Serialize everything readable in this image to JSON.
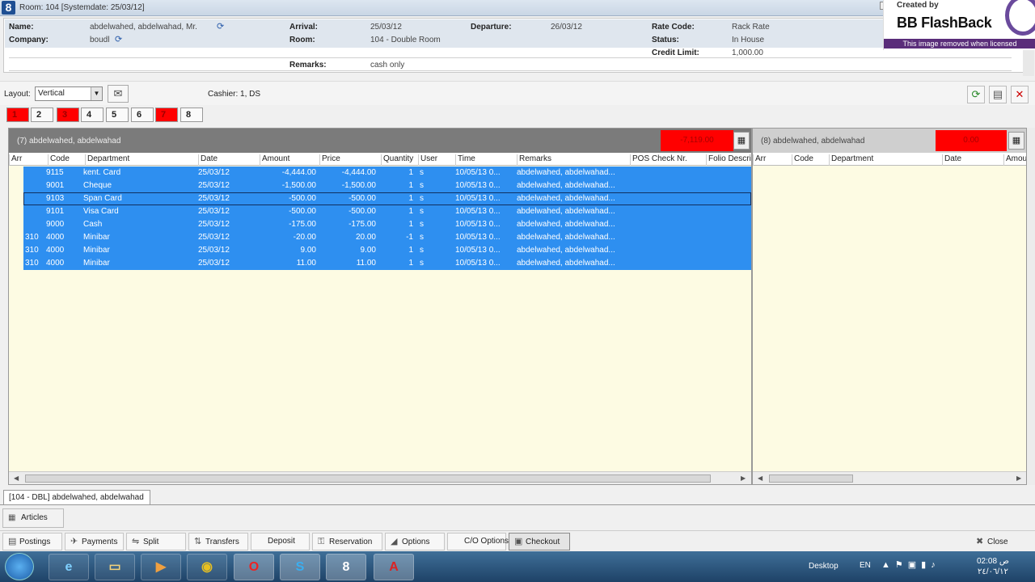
{
  "window": {
    "title": "Room: 104  [Systemdate: 25/03/12]",
    "app_icon": "8"
  },
  "header": {
    "name_label": "Name:",
    "name_value": "abdelwahed, abdelwahad, Mr.",
    "company_label": "Company:",
    "company_value": "boudl",
    "arrival_label": "Arrival:",
    "arrival_value": "25/03/12",
    "departure_label": "Departure:",
    "departure_value": "26/03/12",
    "room_label": "Room:",
    "room_value": "104 - Double Room",
    "remarks_label": "Remarks:",
    "remarks_value": "cash only",
    "ratecode_label": "Rate Code:",
    "ratecode_value": "Rack Rate",
    "status_label": "Status:",
    "status_value": "In House",
    "credit_label": "Credit Limit:",
    "credit_value": "1,000.00"
  },
  "watermark": {
    "created": "Created by",
    "title": "BB FlashBack",
    "strip": "This image removed when licensed"
  },
  "toolbar": {
    "layout_label": "Layout:",
    "layout_value": "Vertical",
    "cashier": "Cashier: 1, DS"
  },
  "window_tabs": [
    {
      "label": "1",
      "red": true
    },
    {
      "label": "2",
      "red": false
    },
    {
      "label": "3",
      "red": true
    },
    {
      "label": "4",
      "red": false
    },
    {
      "label": "5",
      "red": false
    },
    {
      "label": "6",
      "red": false
    },
    {
      "label": "7",
      "red": true
    },
    {
      "label": "8",
      "red": false
    }
  ],
  "left_window": {
    "title": "(7)  abdelwahed, abdelwahad",
    "amount": "-7,119.00",
    "columns": [
      "Arr",
      "Code",
      "Department",
      "Date",
      "Amount",
      "Price",
      "Quantity",
      "User",
      "Time",
      "Remarks",
      "POS Check Nr.",
      "Folio Descri"
    ],
    "rows": [
      {
        "arr": "",
        "code": "9115",
        "dept": "kent. Card",
        "date": "25/03/12",
        "amount": "-4,444.00",
        "price": "-4,444.00",
        "qty": "1",
        "user": "s",
        "time": "10/05/13 0...",
        "remarks": "abdelwahed, abdelwahad..."
      },
      {
        "arr": "",
        "code": "9001",
        "dept": "Cheque",
        "date": "25/03/12",
        "amount": "-1,500.00",
        "price": "-1,500.00",
        "qty": "1",
        "user": "s",
        "time": "10/05/13 0...",
        "remarks": "abdelwahed, abdelwahad..."
      },
      {
        "arr": "",
        "code": "9103",
        "dept": "Span Card",
        "date": "25/03/12",
        "amount": "-500.00",
        "price": "-500.00",
        "qty": "1",
        "user": "s",
        "time": "10/05/13 0...",
        "remarks": "abdelwahed, abdelwahad..."
      },
      {
        "arr": "",
        "code": "9101",
        "dept": "Visa Card",
        "date": "25/03/12",
        "amount": "-500.00",
        "price": "-500.00",
        "qty": "1",
        "user": "s",
        "time": "10/05/13 0...",
        "remarks": "abdelwahed, abdelwahad..."
      },
      {
        "arr": "",
        "code": "9000",
        "dept": "Cash",
        "date": "25/03/12",
        "amount": "-175.00",
        "price": "-175.00",
        "qty": "1",
        "user": "s",
        "time": "10/05/13 0...",
        "remarks": "abdelwahed, abdelwahad..."
      },
      {
        "arr": "310",
        "code": "4000",
        "dept": "Minibar",
        "date": "25/03/12",
        "amount": "-20.00",
        "price": "20.00",
        "qty": "-1",
        "user": "s",
        "time": "10/05/13 0...",
        "remarks": "abdelwahed, abdelwahad..."
      },
      {
        "arr": "310",
        "code": "4000",
        "dept": "Minibar",
        "date": "25/03/12",
        "amount": "9.00",
        "price": "9.00",
        "qty": "1",
        "user": "s",
        "time": "10/05/13 0...",
        "remarks": "abdelwahed, abdelwahad..."
      },
      {
        "arr": "310",
        "code": "4000",
        "dept": "Minibar",
        "date": "25/03/12",
        "amount": "11.00",
        "price": "11.00",
        "qty": "1",
        "user": "s",
        "time": "10/05/13 0...",
        "remarks": "abdelwahed, abdelwahad..."
      }
    ]
  },
  "right_window": {
    "title": "(8)  abdelwahed, abdelwahad",
    "amount": "0.00",
    "columns": [
      "Arr",
      "Code",
      "Department",
      "Date",
      "Amou"
    ]
  },
  "bottom": {
    "room_tab": "[104 - DBL] abdelwahed, abdelwahad",
    "articles": "Articles",
    "buttons": [
      "Postings",
      "Payments",
      "Split",
      "Transfers",
      "Deposit",
      "Reservation",
      "Options",
      "C/O Options",
      "Checkout"
    ],
    "close": "Close"
  },
  "taskbar": {
    "desktop": "Desktop",
    "lang": "EN",
    "time": "02:08 ص",
    "date": "٢٤/٠٦/١٢",
    "app8": "8"
  },
  "colors": {
    "selection": "#2e8ff0",
    "panel_bg": "#fdfbe3",
    "red": "#ff0000"
  }
}
